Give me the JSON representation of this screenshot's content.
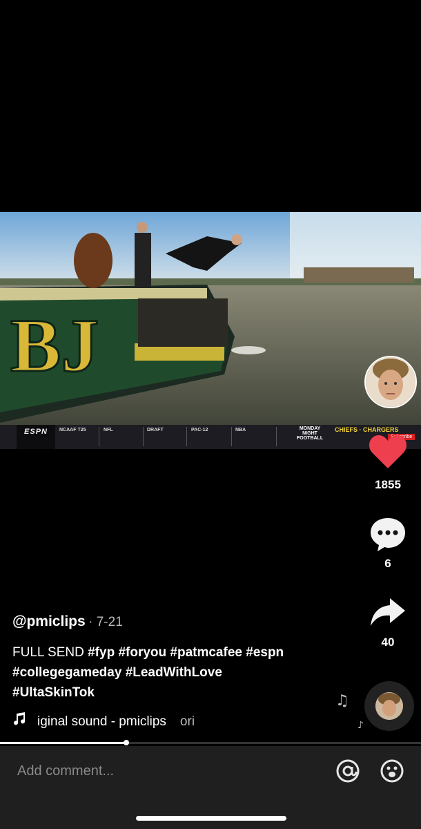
{
  "video": {
    "broadcast_bar": {
      "network": "ESPN",
      "items": [
        "NCAAF T25",
        "NFL",
        "DRAFT",
        "PAC-12",
        "NBA"
      ],
      "promo_line1": "MONDAY",
      "promo_line2": "NIGHT",
      "promo_line3": "FOOTBALL",
      "matchup": "CHIEFS · CHARGERS",
      "subscribe": "Subscribe"
    }
  },
  "actions": {
    "likes": "1855",
    "comments": "6",
    "shares": "40",
    "like_color": "#ee3f4f"
  },
  "post": {
    "handle": "@pmiclips",
    "date": "· 7-21",
    "caption_text": "FULL SEND",
    "hashtags_line1": "#fyp #foryou #patmcafee #espn",
    "hashtags_line2": "#collegegameday #LeadWithLove",
    "hashtags_line3": "#UltaSkinTok",
    "sound_text": "iginal sound - pmiclips",
    "sound_tail": "ori"
  },
  "progress": {
    "fraction": 0.3
  },
  "comment_bar": {
    "placeholder": "Add comment...",
    "mention_icon": "at-icon",
    "emoji_icon": "emoji-icon"
  }
}
